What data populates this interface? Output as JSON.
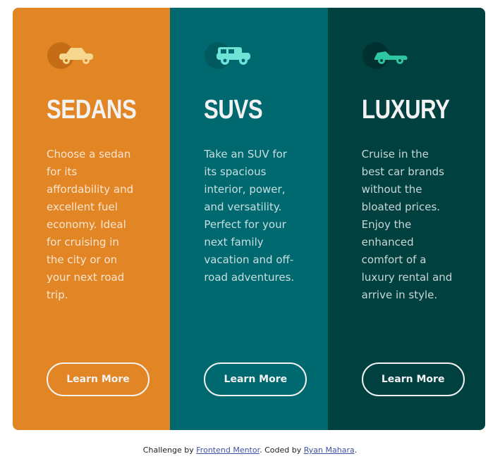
{
  "cards": [
    {
      "title": "SEDANS",
      "text": "Choose a sedan for its affordability and excellent fuel economy. Ideal for cruising in the city or on your next road trip.",
      "button_label": "Learn More",
      "icon": "sedan-car-icon",
      "background": "#e28625"
    },
    {
      "title": "SUVS",
      "text": "Take an SUV for its spacious interior, power, and versatility. Perfect for your next family vacation and off-road adventures.",
      "button_label": "Learn More",
      "icon": "suv-car-icon",
      "background": "#006970"
    },
    {
      "title": "LUXURY",
      "text": "Cruise in the best car brands without the bloated prices. Enjoy the enhanced comfort of a luxury rental and arrive in style.",
      "button_label": "Learn More",
      "icon": "luxury-car-icon",
      "background": "#004140"
    }
  ],
  "attribution": {
    "prefix": "Challenge by ",
    "link1": "Frontend Mentor",
    "middle": ". Coded by ",
    "link2": "Ryan Mahara",
    "suffix": "."
  }
}
